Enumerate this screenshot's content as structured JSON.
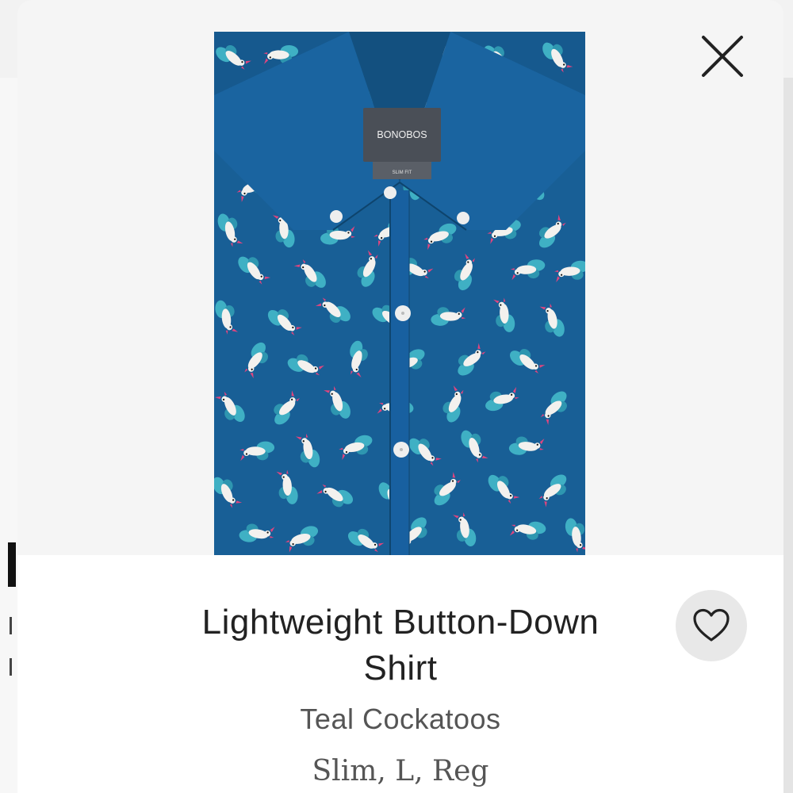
{
  "product": {
    "brand_label": "BONOBOS",
    "size_label": "SLIM FIT",
    "title": "Lightweight Button-Down Shirt",
    "color_name": "Teal Cockatoos",
    "selection": "Slim, L, Reg"
  },
  "colors": {
    "shirt": "#16598e",
    "accent_teal": "#3fb0c4",
    "bird_white": "#f3f1ee",
    "beak_pink": "#e0457f"
  },
  "icons": {
    "close": "close-icon",
    "favorite": "heart-icon"
  }
}
